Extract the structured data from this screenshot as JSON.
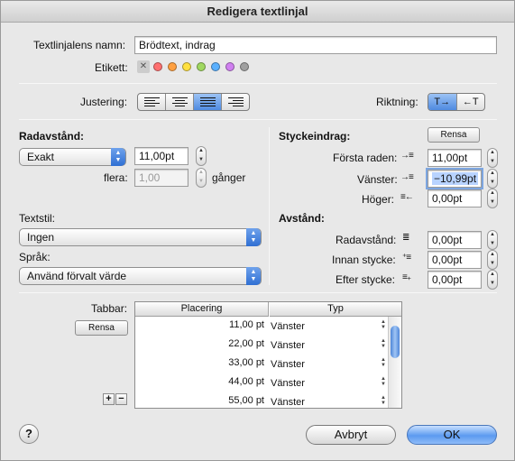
{
  "window": {
    "title": "Redigera textlinjal"
  },
  "header": {
    "name_label": "Textlinjalens namn:",
    "name_value": "Brödtext, indrag",
    "label_label": "Etikett:",
    "label_colors": [
      "#ff7070",
      "#ffa040",
      "#ffe040",
      "#a0d860",
      "#5ab0ff",
      "#d080f0",
      "#a0a0a0"
    ]
  },
  "alignment": {
    "label": "Justering:",
    "options": [
      "left",
      "center",
      "justify",
      "right"
    ],
    "selected": "justify"
  },
  "direction": {
    "label": "Riktning:",
    "options": [
      "ltr",
      "rtl"
    ],
    "selected": "ltr",
    "ltr_glyph": "T→",
    "rtl_glyph": "←T"
  },
  "line_spacing": {
    "heading": "Radavstånd:",
    "mode": "Exakt",
    "value": "11,00pt",
    "multiple_label": "flera:",
    "multiple_value": "1,00",
    "times_label": "gånger"
  },
  "text_style": {
    "label": "Textstil:",
    "value": "Ingen"
  },
  "language": {
    "label": "Språk:",
    "value": "Använd förvalt värde"
  },
  "indent": {
    "heading": "Styckeindrag:",
    "clear_label": "Rensa",
    "first_line_label": "Första raden:",
    "first_line_value": "11,00pt",
    "left_label": "Vänster:",
    "left_value": "−10,99pt",
    "right_label": "Höger:",
    "right_value": "0,00pt"
  },
  "spacing": {
    "heading": "Avstånd:",
    "line_label": "Radavstånd:",
    "line_value": "0,00pt",
    "before_label": "Innan stycke:",
    "before_value": "0,00pt",
    "after_label": "Efter stycke:",
    "after_value": "0,00pt"
  },
  "tabs": {
    "label": "Tabbar:",
    "clear_label": "Rensa",
    "col_position": "Placering",
    "col_type": "Typ",
    "rows": [
      {
        "position": "11,00 pt",
        "type": "Vänster"
      },
      {
        "position": "22,00 pt",
        "type": "Vänster"
      },
      {
        "position": "33,00 pt",
        "type": "Vänster"
      },
      {
        "position": "44,00 pt",
        "type": "Vänster"
      },
      {
        "position": "55,00 pt",
        "type": "Vänster"
      }
    ],
    "add_label": "+",
    "remove_label": "−"
  },
  "footer": {
    "help_label": "?",
    "cancel_label": "Avbryt",
    "ok_label": "OK"
  }
}
